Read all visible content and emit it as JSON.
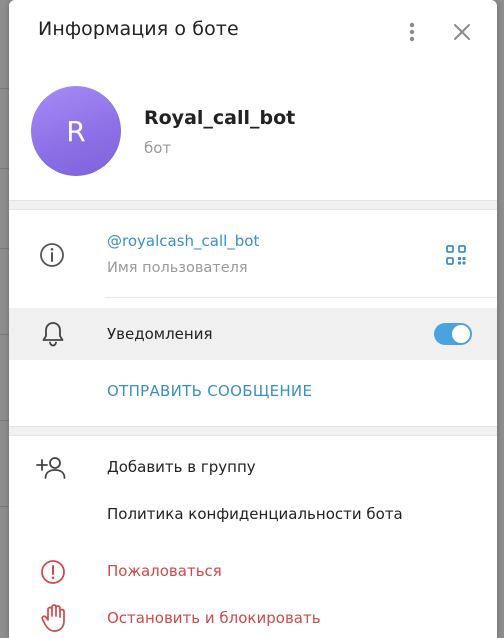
{
  "header": {
    "title": "Информация о боте",
    "more_icon": "kebab-vertical-icon",
    "close_icon": "close-icon"
  },
  "profile": {
    "avatar_letter": "R",
    "avatar_color": "#9478ea",
    "name": "Royal_call_bot",
    "type": "бот"
  },
  "info": {
    "username": "@royalcash_call_bot",
    "username_caption": "Имя пользователя",
    "info_icon": "info-circle-icon",
    "qr_icon": "qr-code-icon"
  },
  "notifications": {
    "label": "Уведомления",
    "enabled": true,
    "icon": "bell-icon"
  },
  "send_message": {
    "label": "ОТПРАВИТЬ СООБЩЕНИЕ"
  },
  "menu": {
    "add_to_group": "Добавить в группу",
    "privacy_policy": "Политика конфиденциальности бота",
    "report": "Пожаловаться",
    "stop_and_block": "Остановить и блокировать"
  },
  "colors": {
    "accent": "#3a8fcb",
    "toggle": "#4aa3df",
    "danger": "#d24949"
  }
}
